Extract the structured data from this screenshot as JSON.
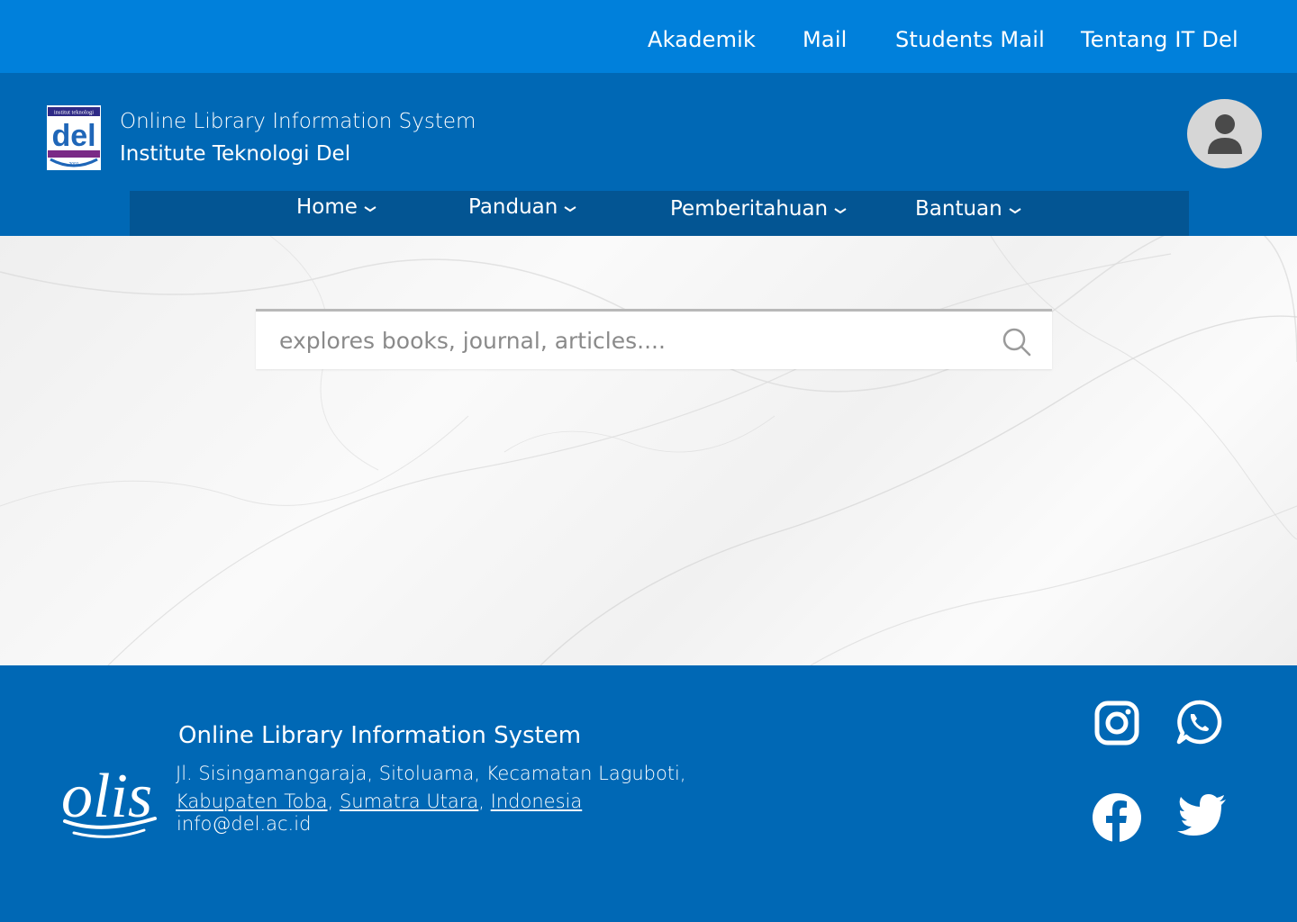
{
  "topbar": {
    "links": [
      "Akademik",
      "Mail",
      "Students Mail",
      "Tentang IT Del"
    ]
  },
  "header": {
    "subtitle": "Online Library Information System",
    "title": "Institute Teknologi Del",
    "logo_top_text": "institut teknologi",
    "logo_text": "del",
    "logo_year": "2001"
  },
  "nav": {
    "items": [
      "Home",
      "Panduan",
      "Pemberitahuan",
      "Bantuan"
    ]
  },
  "search": {
    "placeholder": "explores books, journal, articles...."
  },
  "footer": {
    "title": "Online Library Information System",
    "address_line1": "Jl. Sisingamangaraja, Sitoluama, Kecamatan Laguboti,",
    "links": [
      "Kabupaten Toba",
      "Sumatra Utara",
      "Indonesia"
    ],
    "separator": ",",
    "email": "info@del.ac.id",
    "logo_text": "olis"
  },
  "icons": {
    "avatar": "user-avatar-icon",
    "search": "search-icon",
    "chevron": "chevron-down-icon",
    "social": [
      "instagram-icon",
      "whatsapp-icon",
      "facebook-icon",
      "twitter-icon"
    ]
  },
  "colors": {
    "topbar": "#0080db",
    "header": "#0068b5",
    "navbar": "#035593",
    "footer": "#0068b5",
    "text": "#ffffff"
  }
}
